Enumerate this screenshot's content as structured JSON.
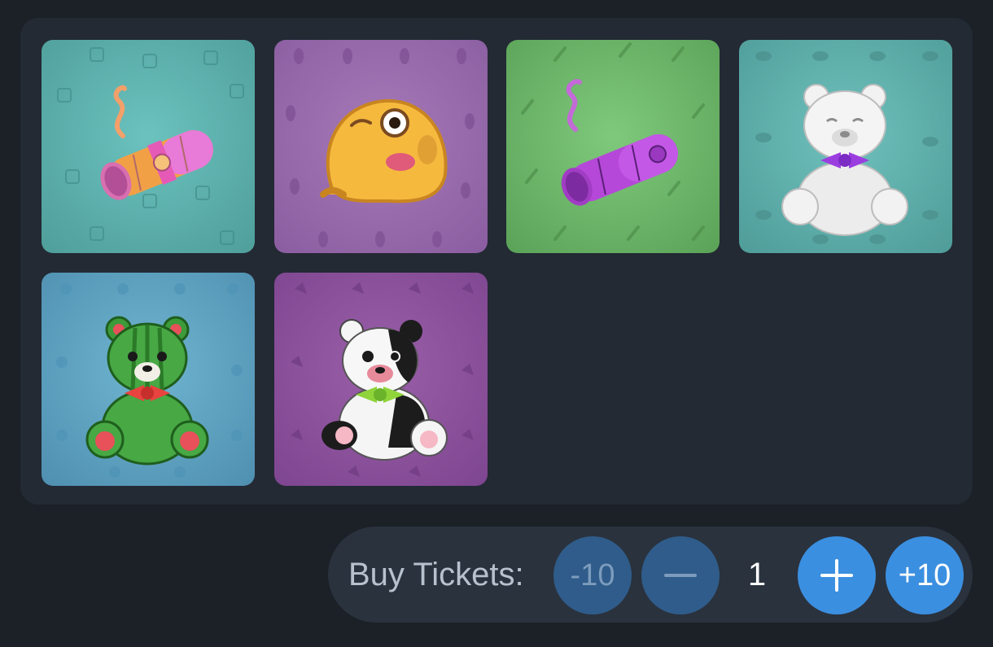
{
  "gifts": [
    {
      "name": "cigar",
      "icon": "cigar-icon",
      "bg_color": "#5caeaa"
    },
    {
      "name": "toad",
      "icon": "toad-icon",
      "bg_color": "#986bac"
    },
    {
      "name": "cigar",
      "icon": "cigar-icon",
      "bg_color": "#6cb569"
    },
    {
      "name": "bear",
      "icon": "white-bear-icon",
      "bg_color": "#5faeab"
    },
    {
      "name": "bear",
      "icon": "watermelon-bear-icon",
      "bg_color": "#5fa2c0"
    },
    {
      "name": "bear",
      "icon": "panda-bear-icon",
      "bg_color": "#8c529c"
    }
  ],
  "tickets": {
    "label": "Buy Tickets:",
    "minus_ten_label": "-10",
    "plus_ten_label": "+10",
    "count": "1"
  },
  "colors": {
    "accent": "#3b8fe0",
    "accent_dim": "#2f5c8a",
    "panel": "#232a34",
    "background": "#1c2027"
  }
}
